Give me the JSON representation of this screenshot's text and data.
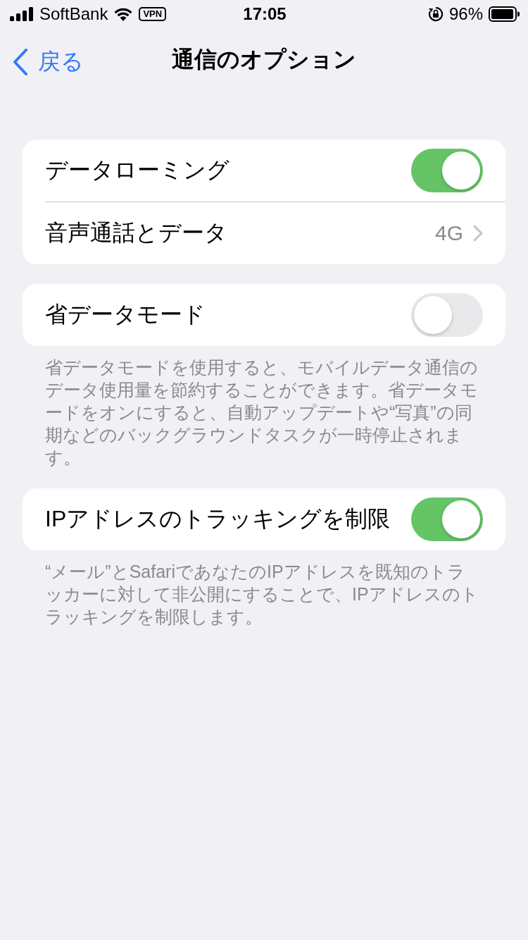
{
  "status_bar": {
    "carrier": "SoftBank",
    "vpn": "VPN",
    "time": "17:05",
    "battery": "96%"
  },
  "nav": {
    "back": "戻る",
    "title": "通信のオプション"
  },
  "groups": [
    {
      "rows": [
        {
          "kind": "toggle",
          "label": "データローミング",
          "on": true
        },
        {
          "kind": "link",
          "label": "音声通話とデータ",
          "value": "4G"
        }
      ]
    },
    {
      "rows": [
        {
          "kind": "toggle",
          "label": "省データモード",
          "on": false
        }
      ],
      "footer": "省データモードを使用すると、モバイルデータ通信のデータ使用量を節約することができます。省データモードをオンにすると、自動アップデートや“写真”の同期などのバックグラウンドタスクが一時停止されます。"
    },
    {
      "rows": [
        {
          "kind": "toggle",
          "label": "IPアドレスのトラッキングを制限",
          "on": true
        }
      ],
      "footer": "“メール”とSafariであなたのIPアドレスを既知のトラッカーに対して非公開にすることで、IPアドレスのトラッキングを制限します。"
    }
  ]
}
